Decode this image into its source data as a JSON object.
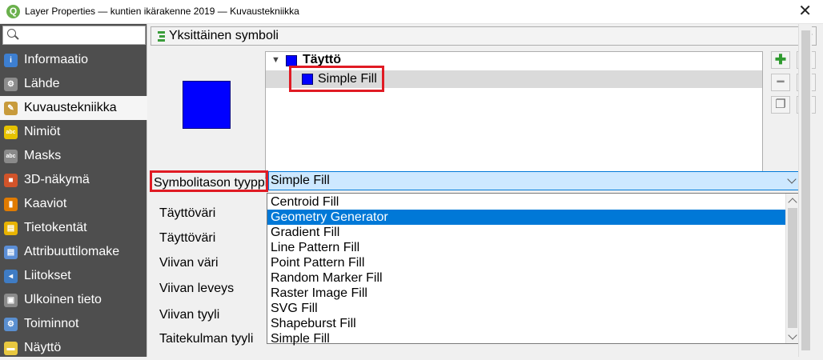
{
  "window": {
    "title": "Layer Properties — kuntien ikärakenne 2019 — Kuvaustekniikka",
    "app_icon_text": "Q",
    "close_glyph": "✕"
  },
  "sidebar": {
    "search_placeholder": "",
    "items": [
      {
        "label": "Informaatio",
        "icon": "info-icon",
        "color": "#3d7fd1",
        "glyph": "i"
      },
      {
        "label": "Lähde",
        "icon": "source-wrench-icon",
        "color": "#8d8d8d",
        "glyph": "⚙"
      },
      {
        "label": "Kuvaustekniikka",
        "icon": "symbology-brush-icon",
        "color": "#c89b3c",
        "glyph": "✎"
      },
      {
        "label": "Nimiöt",
        "icon": "labels-abc-icon",
        "color": "#e6c200",
        "glyph": "abc"
      },
      {
        "label": "Masks",
        "icon": "masks-abc-icon",
        "color": "#8a8a8a",
        "glyph": "abc"
      },
      {
        "label": "3D-näkymä",
        "icon": "3d-cube-icon",
        "color": "#d2542a",
        "glyph": "■"
      },
      {
        "label": "Kaaviot",
        "icon": "diagrams-icon",
        "color": "#e07b00",
        "glyph": "▮"
      },
      {
        "label": "Tietokentät",
        "icon": "fields-table-icon",
        "color": "#e8b300",
        "glyph": "▤"
      },
      {
        "label": "Attribuuttilomake",
        "icon": "attribute-form-icon",
        "color": "#5b8ed6",
        "glyph": "▤"
      },
      {
        "label": "Liitokset",
        "icon": "joins-icon",
        "color": "#3f7cc4",
        "glyph": "◂"
      },
      {
        "label": "Ulkoinen tieto",
        "icon": "auxiliary-storage-icon",
        "color": "#8b8b8b",
        "glyph": "▣"
      },
      {
        "label": "Toiminnot",
        "icon": "actions-gear-icon",
        "color": "#5a8fd0",
        "glyph": "⚙"
      },
      {
        "label": "Näyttö",
        "icon": "display-bubble-icon",
        "color": "#e8c840",
        "glyph": "▬"
      }
    ],
    "active_index": 2
  },
  "renderer": {
    "label": "Yksittäinen symboli"
  },
  "symbol_tree": {
    "root_label": "Täyttö",
    "child_label": "Simple Fill",
    "swatch_color": "#0000ff"
  },
  "side_buttons": {
    "add": "✚",
    "remove": "━",
    "up": "▲",
    "down": "▼",
    "duplicate": "❐",
    "lock": "🔒"
  },
  "symbol_layer": {
    "type_label": "Symbolitason tyyppi",
    "type_value": "Simple Fill",
    "options": [
      "Centroid Fill",
      "Geometry Generator",
      "Gradient Fill",
      "Line Pattern Fill",
      "Point Pattern Fill",
      "Random Marker Fill",
      "Raster Image Fill",
      "SVG Fill",
      "Shapeburst Fill",
      "Simple Fill"
    ],
    "highlighted_option": "Geometry Generator"
  },
  "properties": [
    "Täyttöväri",
    "Täyttöväri",
    "Viivan väri",
    "Viivan leveys",
    "Viivan tyyli",
    "Taitekulman tyyli"
  ],
  "colors": {
    "fill": "#0000ff",
    "selection": "#0078d7",
    "annotation": "#e01b24"
  }
}
